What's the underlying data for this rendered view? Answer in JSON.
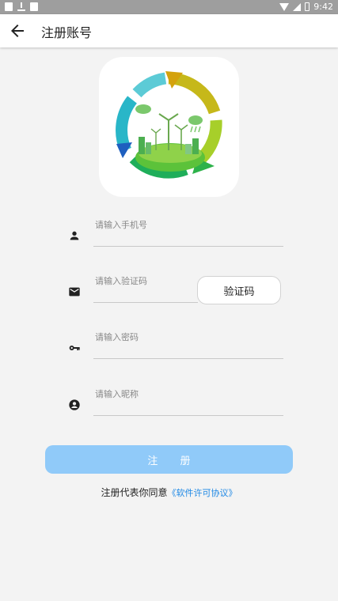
{
  "status_bar": {
    "time": "9:42"
  },
  "header": {
    "title": "注册账号"
  },
  "form": {
    "phone_placeholder": "请输入手机号",
    "code_placeholder": "请输入验证码",
    "code_button": "验证码",
    "password_placeholder": "请输入密码",
    "nickname_placeholder": "请输入昵称"
  },
  "register_button": "注  册",
  "agreement": {
    "prefix": "注册代表你同意",
    "link": "《软件许可协议》"
  },
  "colors": {
    "accent": "#90caf9",
    "link": "#1e88e5",
    "background": "#f3f3f3"
  }
}
